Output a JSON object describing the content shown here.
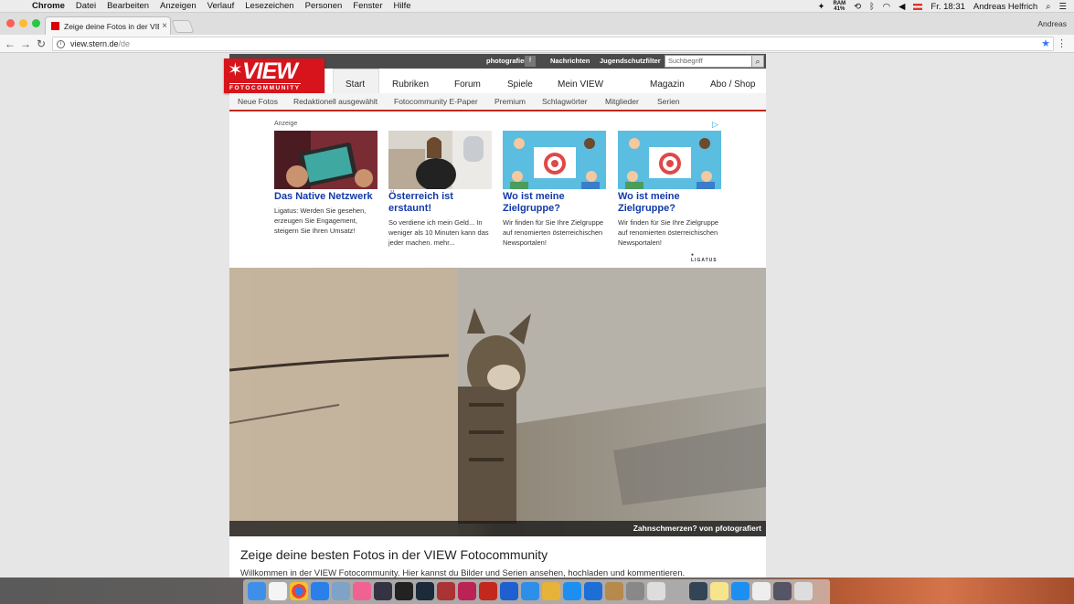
{
  "menubar": {
    "app": "Chrome",
    "items": [
      "Datei",
      "Bearbeiten",
      "Anzeigen",
      "Verlauf",
      "Lesezeichen",
      "Personen",
      "Fenster",
      "Hilfe"
    ],
    "ram_label": "RAM",
    "ram_value": "41%",
    "clock": "Fr. 18:31",
    "user": "Andreas Helfrich"
  },
  "browser": {
    "tab_title": "Zeige deine Fotos in der VIEW",
    "profile": "Andreas",
    "url_host": "view.stern.de",
    "url_path": "/de"
  },
  "site": {
    "logo_word": "VIEW",
    "logo_sub": "FOTOCOMMUNITY",
    "top_links": [
      "photografiert",
      "Nachrichten",
      "Jugendschutzfilter"
    ],
    "search_placeholder": "Suchbegriff",
    "main_nav": [
      "Start",
      "Rubriken",
      "Forum",
      "Spiele",
      "Mein VIEW",
      "Magazin",
      "Abo / Shop"
    ],
    "active_nav": "Start",
    "sub_nav": [
      "Neue Fotos",
      "Redaktionell ausgewählt",
      "Fotocommunity E-Paper",
      "Premium",
      "Schlagwörter",
      "Mitglieder",
      "Serien"
    ]
  },
  "ad": {
    "label": "Anzeige",
    "brand": "LIGATUS",
    "cards": [
      {
        "title": "Das Native Netzwerk",
        "desc": "Ligatus: Werden Sie gesehen, erzeugen Sie Engagement, steigern Sie Ihren Umsatz!"
      },
      {
        "title": "Österreich ist erstaunt!",
        "desc": "So verdiene ich mein Geld... In weniger als 10 Minuten kann das jeder machen. mehr..."
      },
      {
        "title": "Wo ist meine Zielgruppe?",
        "desc": "Wir finden für Sie Ihre Zielgruppe auf renomierten österreichischen Newsportalen!"
      },
      {
        "title": "Wo ist meine Zielgruppe?",
        "desc": "Wir finden für Sie Ihre Zielgruppe auf renomierten österreichischen Newsportalen!"
      }
    ]
  },
  "hero": {
    "caption": "Zahnschmerzen? von pfotografiert"
  },
  "intro": {
    "title": "Zeige deine besten Fotos in der VIEW Fotocommunity",
    "text": "Willkommen in der VIEW Fotocommunity. Hier kannst du Bilder und Serien ansehen, hochladen und kommentieren."
  },
  "colors": {
    "brand_red": "#d7141c",
    "link_blue": "#123aa8",
    "accent_line": "#c3281e"
  }
}
